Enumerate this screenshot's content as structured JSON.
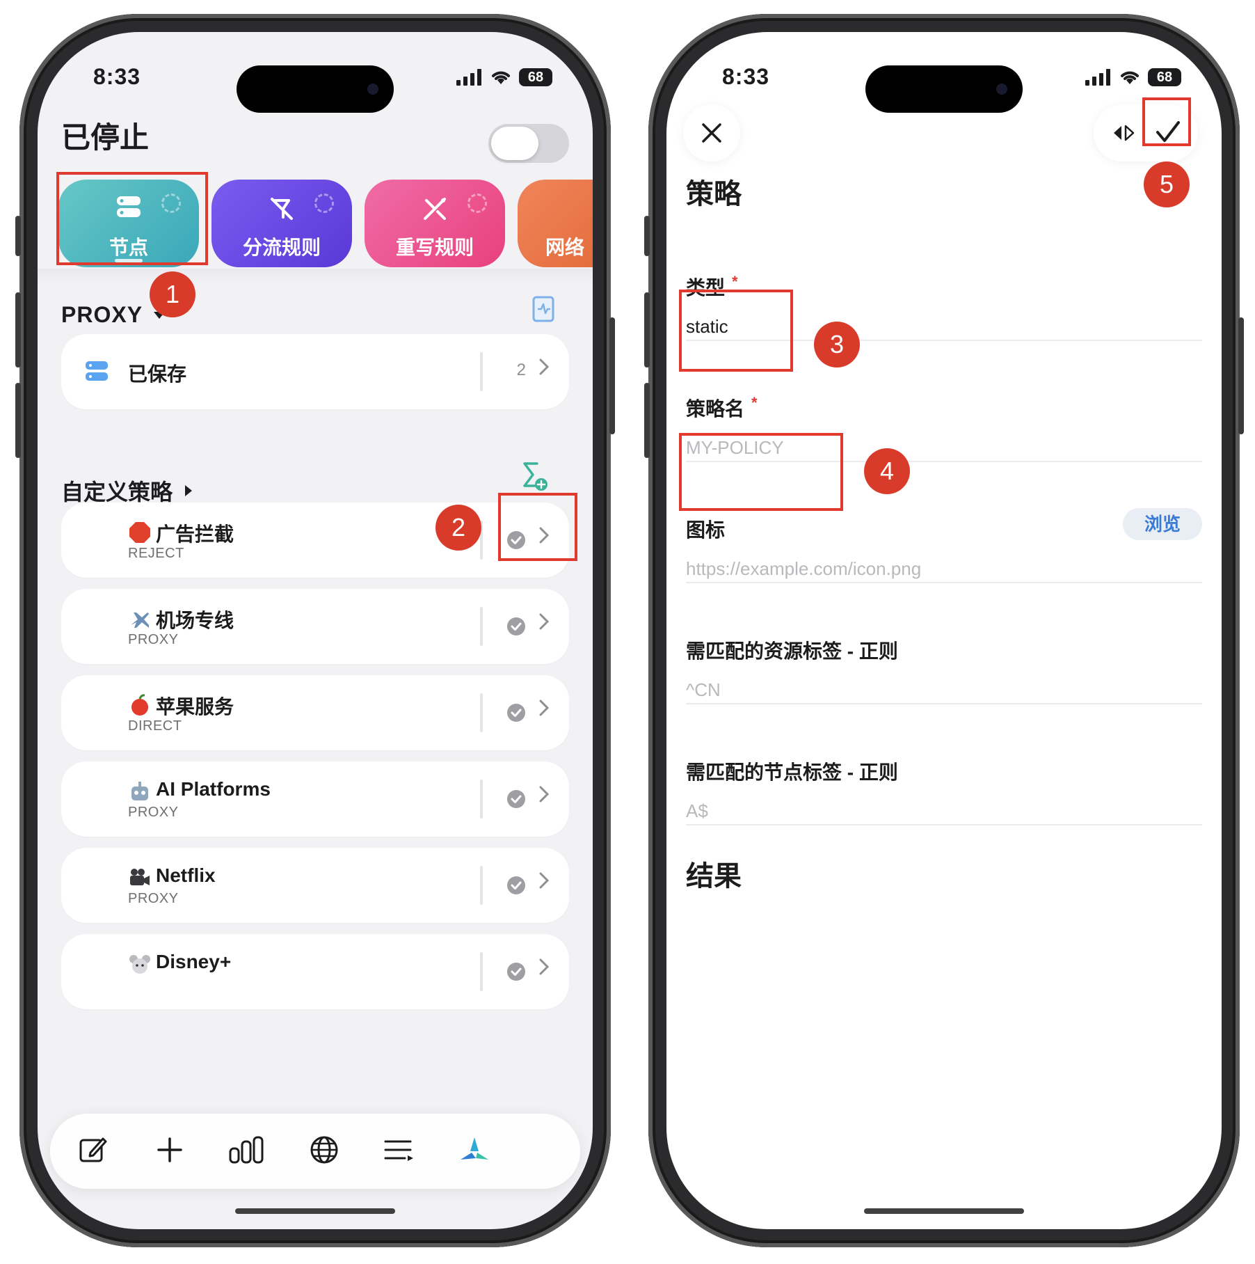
{
  "left_phone": {
    "status": {
      "time": "8:33",
      "battery": "68"
    },
    "title": "已停止",
    "tiles": [
      {
        "label": "节点",
        "icon": "server-icon"
      },
      {
        "label": "分流规则",
        "icon": "split-rules-icon"
      },
      {
        "label": "重写规则",
        "icon": "rewrite-rules-icon"
      },
      {
        "label": "网络",
        "icon": "network-icon"
      }
    ],
    "proxy_section": {
      "label": "PROXY"
    },
    "saved_card": {
      "label": "已保存",
      "count": "2"
    },
    "custom_section": {
      "label": "自定义策略"
    },
    "policies": [
      {
        "emoji": "stop-sign-icon",
        "name": "广告拦截",
        "sub": "REJECT"
      },
      {
        "emoji": "airplane-icon",
        "name": "机场专线",
        "sub": "PROXY"
      },
      {
        "emoji": "apple-icon",
        "name": "苹果服务",
        "sub": "DIRECT"
      },
      {
        "emoji": "robot-icon",
        "name": "AI Platforms",
        "sub": "PROXY"
      },
      {
        "emoji": "movie-camera-icon",
        "name": "Netflix",
        "sub": "PROXY"
      },
      {
        "emoji": "mouse-icon",
        "name": "Disney+",
        "sub": ""
      }
    ],
    "bottom_bar": [
      "edit-icon",
      "plus-icon",
      "stats-icon",
      "globe-icon",
      "list-icon",
      "app-logo-icon"
    ]
  },
  "right_phone": {
    "status": {
      "time": "8:33",
      "battery": "68"
    },
    "title": "策略",
    "fields": {
      "type": {
        "label": "类型",
        "required": "*",
        "value": "static"
      },
      "name": {
        "label": "策略名",
        "required": "*",
        "placeholder": "MY-POLICY"
      },
      "icon": {
        "label": "图标",
        "placeholder": "https://example.com/icon.png",
        "browse": "浏览"
      },
      "resource_regex": {
        "label": "需匹配的资源标签 - 正则",
        "placeholder": "^CN"
      },
      "node_regex": {
        "label": "需匹配的节点标签 - 正则",
        "placeholder": "A$"
      }
    },
    "result_label": "结果"
  },
  "annotations": {
    "badges": [
      "1",
      "2",
      "3",
      "4",
      "5"
    ],
    "color": "#e03a2f"
  },
  "colors": {
    "tile_nodes": "#4fb6c0",
    "tile_split": "#6a4ae4",
    "tile_rewrite": "#ec5690",
    "tile_net": "#e8734a",
    "accent_blue": "#3a7bd5",
    "required_red": "#e53935"
  }
}
